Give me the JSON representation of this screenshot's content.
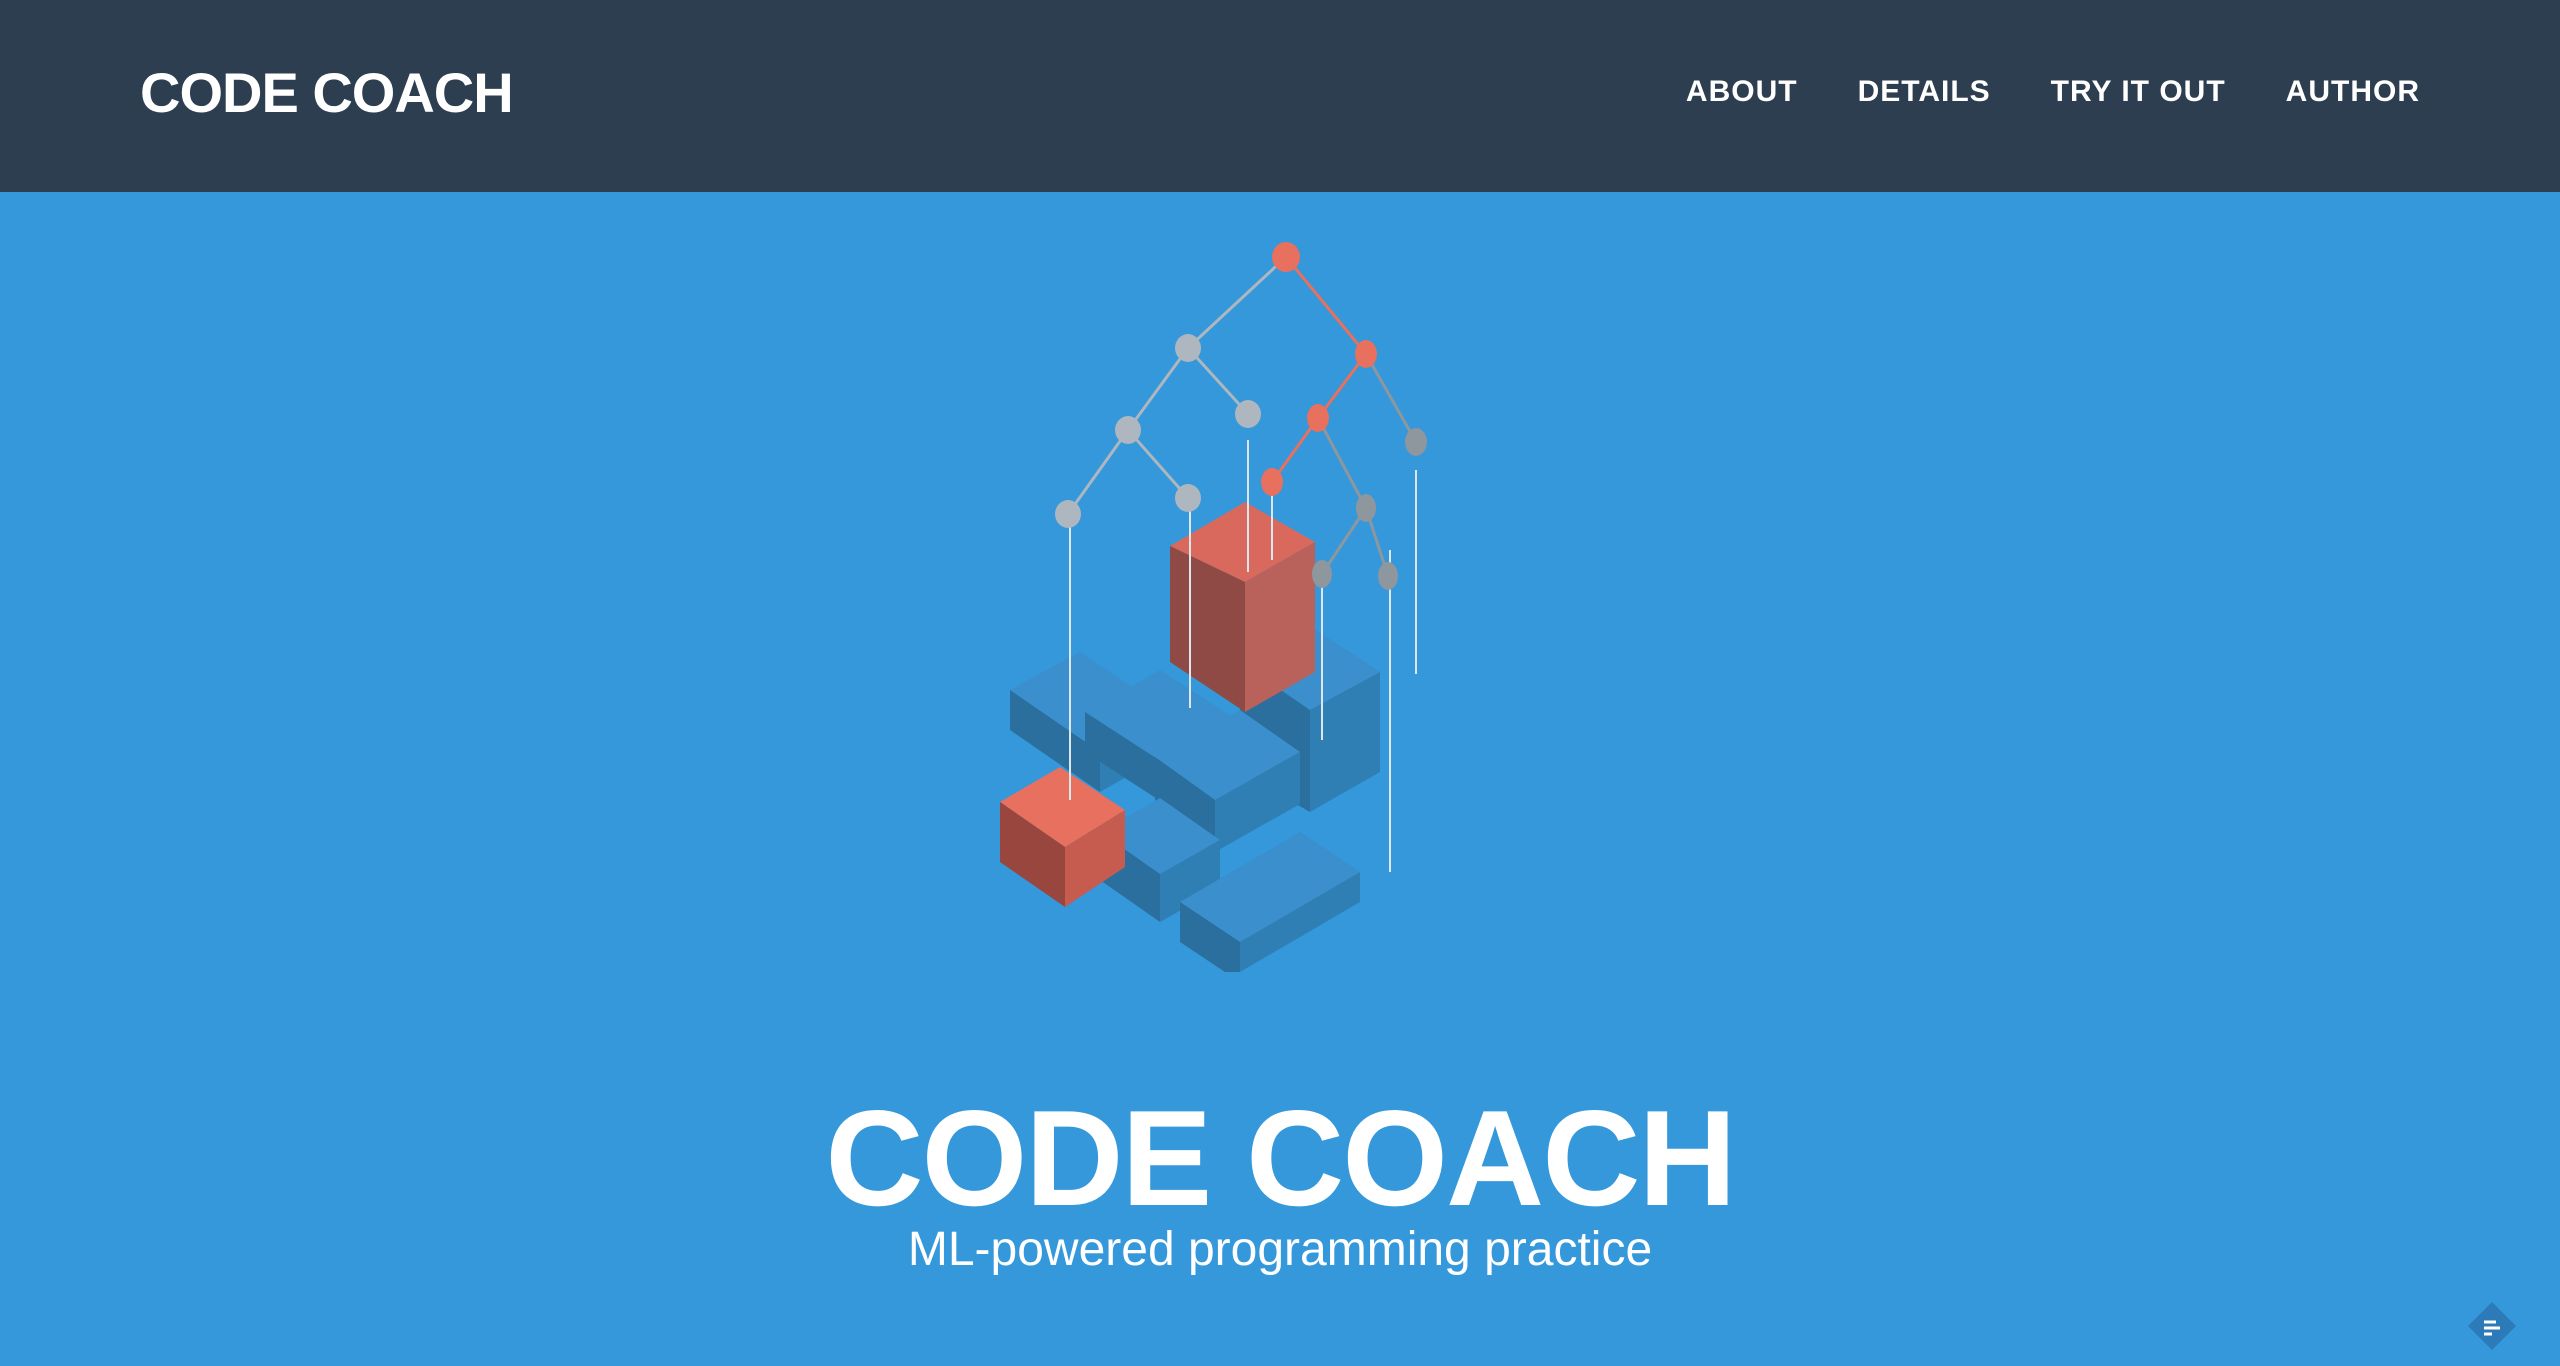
{
  "navbar": {
    "brand": "CODE COACH",
    "links": [
      "ABOUT",
      "DETAILS",
      "TRY IT OUT",
      "AUTHOR"
    ]
  },
  "hero": {
    "title": "CODE COACH",
    "subtitle": "ML-powered programming practice",
    "illustration_icon": "decision-tree-blocks-illustration"
  },
  "widgets": {
    "feedback_icon": "feedback-badge-icon"
  },
  "colors": {
    "navbar_bg": "#2c3e50",
    "hero_bg": "#3498db",
    "accent_red": "#e8705e",
    "node_gray": "#aeb6bf",
    "text": "#ffffff"
  }
}
